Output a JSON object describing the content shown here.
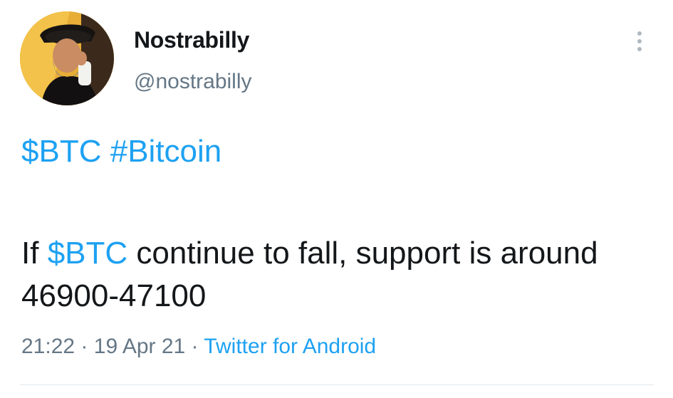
{
  "tweet": {
    "author": {
      "display_name": "Nostrabilly",
      "handle": "@nostrabilly"
    },
    "tags": {
      "cashtag": "$BTC",
      "hashtag": "#Bitcoin"
    },
    "body": {
      "prefix": "If ",
      "cashtag": "$BTC",
      "suffix": " continue to fall, support is around 46900-47100"
    },
    "meta": {
      "time": "21:22",
      "separator": "·",
      "date": "19 Apr 21",
      "source": "Twitter for Android"
    },
    "icons": {
      "more": "more-vertical-icon",
      "avatar": "profile-avatar"
    },
    "colors": {
      "link": "#1da1f2",
      "text": "#14171a",
      "muted": "#657786"
    }
  }
}
